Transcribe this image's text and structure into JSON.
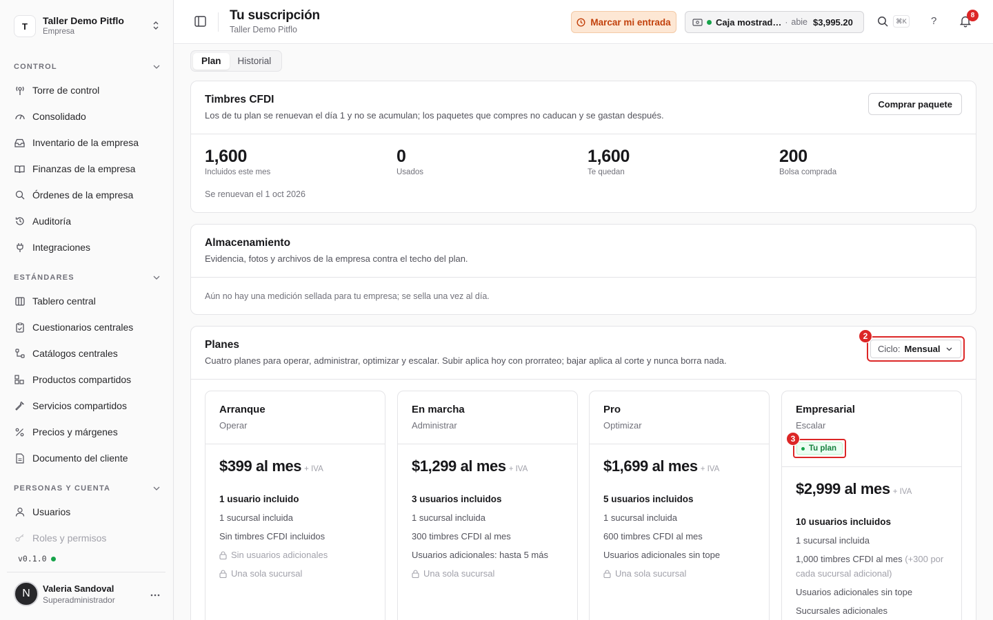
{
  "org": {
    "initial": "T",
    "name": "Taller Demo Pitflo",
    "type": "Empresa"
  },
  "sidebar": {
    "sections": [
      {
        "title": "CONTROL",
        "items": [
          {
            "label": "Torre de control",
            "icon": "antenna-icon"
          },
          {
            "label": "Consolidado",
            "icon": "gauge-icon"
          },
          {
            "label": "Inventario de la empresa",
            "icon": "inbox-icon"
          },
          {
            "label": "Finanzas de la empresa",
            "icon": "book-icon"
          },
          {
            "label": "Órdenes de la empresa",
            "icon": "search-icon"
          },
          {
            "label": "Auditoría",
            "icon": "history-icon"
          },
          {
            "label": "Integraciones",
            "icon": "plug-icon"
          }
        ]
      },
      {
        "title": "ESTÁNDARES",
        "items": [
          {
            "label": "Tablero central",
            "icon": "columns-icon"
          },
          {
            "label": "Cuestionarios centrales",
            "icon": "clipboard-icon"
          },
          {
            "label": "Catálogos centrales",
            "icon": "tree-icon"
          },
          {
            "label": "Productos compartidos",
            "icon": "boxes-icon"
          },
          {
            "label": "Servicios compartidos",
            "icon": "wrench-icon"
          },
          {
            "label": "Precios y márgenes",
            "icon": "percent-icon"
          },
          {
            "label": "Documento del cliente",
            "icon": "document-icon"
          }
        ]
      },
      {
        "title": "PERSONAS Y CUENTA",
        "items": [
          {
            "label": "Usuarios",
            "icon": "user-icon"
          },
          {
            "label": "Roles y permisos",
            "icon": "key-icon"
          }
        ]
      }
    ],
    "version": "v0.1.0"
  },
  "user": {
    "initial": "N",
    "name": "Valeria Sandoval",
    "role": "Superadministrador"
  },
  "header": {
    "title": "Tu suscripción",
    "subtitle": "Taller Demo Pitflo",
    "entry_button": "Marcar mi entrada",
    "cash": {
      "name": "Caja mostrad…",
      "status": "abie",
      "amount": "$3,995.20"
    },
    "shortcut": "⌘K",
    "help": "?",
    "notifications": "8"
  },
  "tabs": [
    {
      "label": "Plan",
      "active": true
    },
    {
      "label": "Historial",
      "active": false
    }
  ],
  "stamps": {
    "title": "Timbres CFDI",
    "description": "Los de tu plan se renuevan el día 1 y no se acumulan; los paquetes que compres no caducan y se gastan después.",
    "buy_button": "Comprar paquete",
    "stats": [
      {
        "value": "1,600",
        "label": "Incluidos este mes"
      },
      {
        "value": "0",
        "label": "Usados"
      },
      {
        "value": "1,600",
        "label": "Te quedan"
      },
      {
        "value": "200",
        "label": "Bolsa comprada"
      }
    ],
    "renewal": "Se renuevan el 1 oct 2026"
  },
  "storage": {
    "title": "Almacenamiento",
    "description": "Evidencia, fotos y archivos de la empresa contra el techo del plan.",
    "empty": "Aún no hay una medición sellada para tu empresa; se sella una vez al día."
  },
  "plans": {
    "title": "Planes",
    "description": "Cuatro planes para operar, administrar, optimizar y escalar. Subir aplica hoy con prorrateo; bajar aplica al corte y nunca borra nada.",
    "cycle_label": "Ciclo:",
    "cycle_value": "Mensual",
    "marker_cycle": "2",
    "marker_current": "3",
    "current_label": "Tu plan",
    "iva": "+ IVA",
    "items": [
      {
        "name": "Arranque",
        "tagline": "Operar",
        "price": "$399 al mes",
        "users": "1 usuario incluido",
        "branch": "1 sucursal incluida",
        "stamps": "Sin timbres CFDI incluidos",
        "extra_users": "Sin usuarios adicionales",
        "extra_branch": "Una sola sucursal"
      },
      {
        "name": "En marcha",
        "tagline": "Administrar",
        "price": "$1,299 al mes",
        "users": "3 usuarios incluidos",
        "branch": "1 sucursal incluida",
        "stamps": "300 timbres CFDI al mes",
        "extra_users": "Usuarios adicionales: hasta 5 más",
        "extra_branch": "Una sola sucursal"
      },
      {
        "name": "Pro",
        "tagline": "Optimizar",
        "price": "$1,699 al mes",
        "users": "5 usuarios incluidos",
        "branch": "1 sucursal incluida",
        "stamps": "600 timbres CFDI al mes",
        "extra_users": "Usuarios adicionales sin tope",
        "extra_branch": "Una sola sucursal"
      },
      {
        "name": "Empresarial",
        "tagline": "Escalar",
        "price": "$2,999 al mes",
        "users": "10 usuarios incluidos",
        "branch": "1 sucursal incluida",
        "stamps": "1,000 timbres CFDI al mes",
        "stamps_extra": "(+300 por cada sucursal adicional)",
        "extra_users": "Usuarios adicionales sin tope",
        "extra_branch": "Sucursales adicionales"
      }
    ]
  },
  "colors": {
    "accent_orange": "#c2410c",
    "success": "#16a34a",
    "alert": "#dc2626"
  }
}
